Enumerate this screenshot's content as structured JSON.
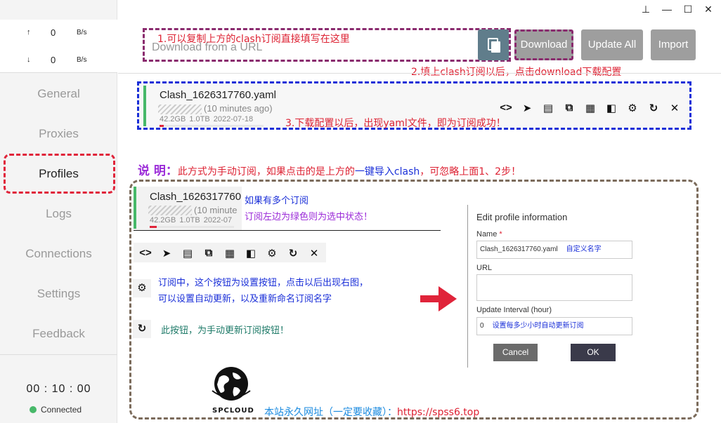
{
  "window": {
    "pin": "⊥",
    "minimize": "—",
    "maximize": "☐",
    "close": "✕"
  },
  "speed": {
    "up_arrow": "↑",
    "up_value": "0",
    "up_unit": "B/s",
    "down_arrow": "↓",
    "down_value": "0",
    "down_unit": "B/s"
  },
  "nav": [
    "General",
    "Proxies",
    "Profiles",
    "Logs",
    "Connections",
    "Settings",
    "Feedback"
  ],
  "status": {
    "clock": "00 : 10 : 00",
    "connection": "Connected"
  },
  "header": {
    "url_placeholder": "Download from a URL",
    "note1": "1.可以复制上方的clash订阅直接填写在这里",
    "download": "Download",
    "update_all": "Update All",
    "import": "Import",
    "note2": "2.填上clash订阅以后，点击download下载配置"
  },
  "profile": {
    "name": "Clash_1626317760.yaml",
    "ago": "(10 minutes ago)",
    "used": "42.2GB",
    "total": "1.0TB",
    "expire": "2022-07-18",
    "progress": 0.04,
    "note3": "3.下载配置以后，出现yaml文件，即为订阅成功！"
  },
  "icons": [
    "<>",
    "➤",
    "▤",
    "⧉",
    "▦",
    "◧",
    "⚙",
    "↻",
    "✕"
  ],
  "explain": {
    "label": "说 明：",
    "text_a": "此方式为手动订阅，如果点击的是上方的",
    "text_b": "一键导入clash",
    "text_c": "，可忽略上面1、2步！"
  },
  "mini_profile": {
    "name": "Clash_1626317760",
    "ago": "(10 minute",
    "used": "42.2GB",
    "total": "1.0TB",
    "expire": "2022-07"
  },
  "annotations": {
    "multi1": "如果有多个订阅",
    "multi2": "订阅左边为绿色则为选中状态！",
    "gear1": "订阅中，这个按钮为设置按钮，点击以后出现右图，",
    "gear2": "可以设置自动更新，以及重新命名订阅名字",
    "refresh": "此按钮，为手动更新订阅按钮！"
  },
  "dialog": {
    "title": "Edit profile information",
    "name_label": "Name",
    "required": "*",
    "name_value": "Clash_1626317760.yaml",
    "name_hint": "自定义名字",
    "url_label": "URL",
    "interval_label": "Update Interval (hour)",
    "interval_value": "0",
    "interval_hint": "设置每多少小时自动更新订阅",
    "cancel": "Cancel",
    "ok": "OK"
  },
  "logo_text": "SPCLOUD",
  "footer": {
    "text": "本站永久网址（一定要收藏）：",
    "url": "https://spss6.top"
  },
  "colors": {
    "accent_green": "#47b869",
    "annotation_red": "#dd2233",
    "annotation_blue": "#1a2fd8",
    "annotation_purple": "#9b2bd8"
  }
}
